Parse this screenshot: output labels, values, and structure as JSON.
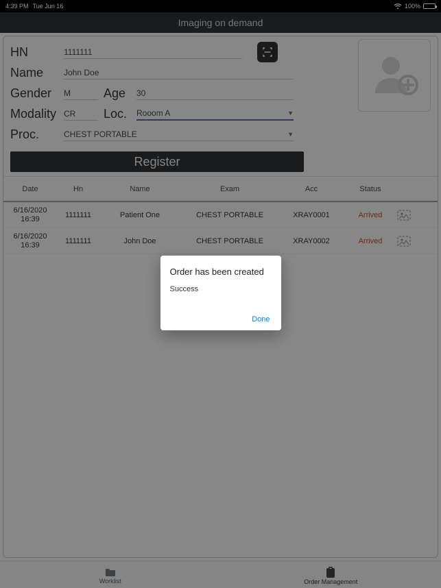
{
  "status_bar": {
    "time": "4:39 PM",
    "date": "Tue Jun 16",
    "battery_pct": "100%"
  },
  "app_title": "Imaging on demand",
  "form": {
    "hn_label": "HN",
    "hn_value": "1111111",
    "name_label": "Name",
    "name_value": "John Doe",
    "gender_label": "Gender",
    "gender_value": "M",
    "age_label": "Age",
    "age_value": "30",
    "modality_label": "Modality",
    "modality_value": "CR",
    "loc_label": "Loc.",
    "loc_value": "Rooom A",
    "proc_label": "Proc.",
    "proc_value": "CHEST PORTABLE",
    "register_label": "Register"
  },
  "table": {
    "headers": {
      "date": "Date",
      "hn": "Hn",
      "name": "Name",
      "exam": "Exam",
      "acc": "Acc",
      "status": "Status"
    },
    "rows": [
      {
        "date_line1": "6/16/2020",
        "date_line2": "16:39",
        "hn": "1111111",
        "name": "Patient One",
        "exam": "CHEST PORTABLE",
        "acc": "XRAY0001",
        "status": "Arrived"
      },
      {
        "date_line1": "6/16/2020",
        "date_line2": "16:39",
        "hn": "1111111",
        "name": "John Doe",
        "exam": "CHEST PORTABLE",
        "acc": "XRAY0002",
        "status": "Arrived"
      }
    ]
  },
  "tabs": {
    "worklist": "Worklist",
    "order_mgmt": "Order Management"
  },
  "dialog": {
    "title": "Order has been created",
    "message": "Success",
    "done": "Done"
  }
}
